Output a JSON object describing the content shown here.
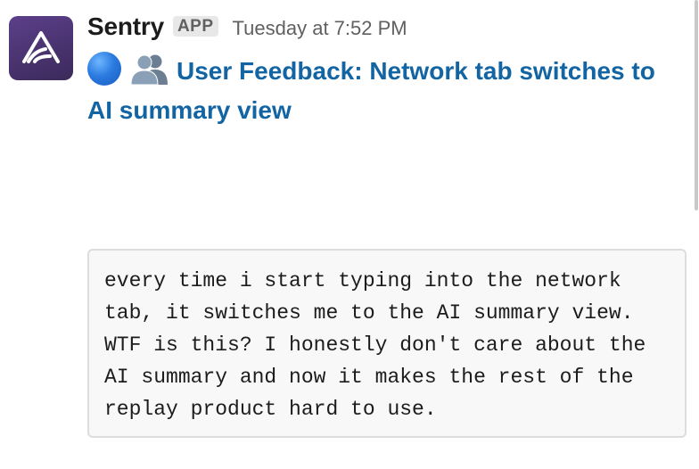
{
  "message": {
    "sender": "Sentry",
    "badge": "APP",
    "timestamp": "Tuesday at 7:52 PM",
    "title": "User Feedback: Network tab switches to AI summary view",
    "title_icons": [
      "blue-circle-icon",
      "people-icon"
    ],
    "body": "every time i start typing into the network tab, it switches me to the AI summary view. WTF is this? I honestly don't care about the AI summary and now it makes the rest of the replay product hard to use."
  },
  "colors": {
    "avatar": "#4a3470",
    "link": "#1264a3",
    "text": "#1d1c1d",
    "muted": "#616061",
    "code_bg": "#f8f8f8",
    "code_border": "#dddddd"
  }
}
